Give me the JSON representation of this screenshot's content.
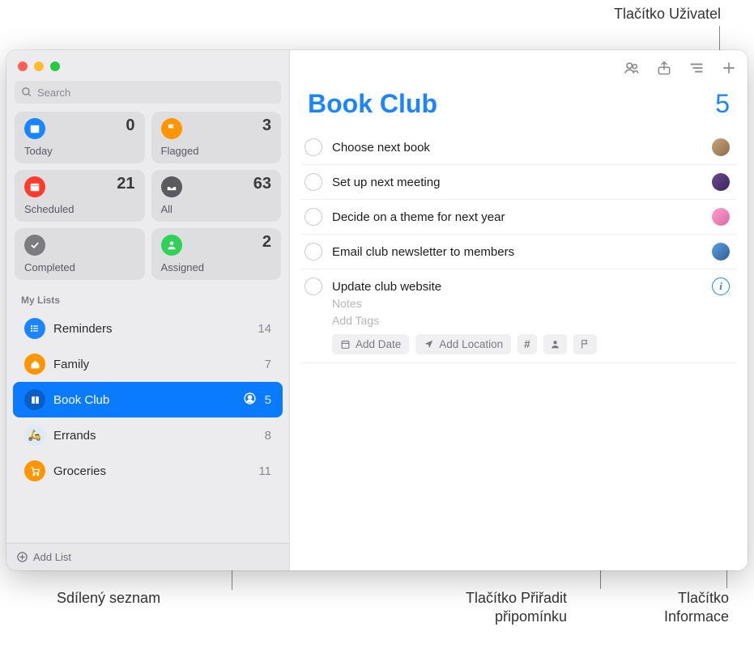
{
  "callouts": {
    "user_button": "Tlačítko Uživatel",
    "shared_list": "Sdílený seznam",
    "assign_button": "Tlačítko Přiřadit\npřipomínku",
    "info_button": "Tlačítko\nInformace"
  },
  "search": {
    "placeholder": "Search"
  },
  "smart_lists": [
    {
      "label": "Today",
      "count": "0",
      "icon": "calendar",
      "color": "si-blue"
    },
    {
      "label": "Flagged",
      "count": "3",
      "icon": "flag",
      "color": "si-orange"
    },
    {
      "label": "Scheduled",
      "count": "21",
      "icon": "calendar-grid",
      "color": "si-red"
    },
    {
      "label": "All",
      "count": "63",
      "icon": "tray",
      "color": "si-dark"
    },
    {
      "label": "Completed",
      "count": "",
      "icon": "check",
      "color": "si-grey"
    },
    {
      "label": "Assigned",
      "count": "2",
      "icon": "person",
      "color": "si-green"
    }
  ],
  "section_title": "My Lists",
  "lists": [
    {
      "name": "Reminders",
      "count": "14",
      "color": "#1a85ff",
      "icon": "list",
      "selected": false,
      "shared": false
    },
    {
      "name": "Family",
      "count": "7",
      "color": "#ff9500",
      "icon": "home",
      "selected": false,
      "shared": false
    },
    {
      "name": "Book Club",
      "count": "5",
      "color": "#1a85ff",
      "icon": "book",
      "selected": true,
      "shared": true
    },
    {
      "name": "Errands",
      "count": "8",
      "color": "#8ec5e8",
      "icon": "scooter",
      "selected": false,
      "shared": false
    },
    {
      "name": "Groceries",
      "count": "11",
      "color": "#ff9500",
      "icon": "cart",
      "selected": false,
      "shared": false
    }
  ],
  "add_list_label": "Add List",
  "main": {
    "title": "Book Club",
    "count": "5",
    "reminders": [
      {
        "title": "Choose next book",
        "avatar": "av1"
      },
      {
        "title": "Set up next meeting",
        "avatar": "av2"
      },
      {
        "title": "Decide on a theme for next year",
        "avatar": "av3"
      },
      {
        "title": "Email club newsletter to members",
        "avatar": "av4"
      },
      {
        "title": "Update club website",
        "expanded": true
      }
    ],
    "expanded": {
      "notes_placeholder": "Notes",
      "tags_placeholder": "Add Tags",
      "add_date": "Add Date",
      "add_location": "Add Location"
    }
  }
}
